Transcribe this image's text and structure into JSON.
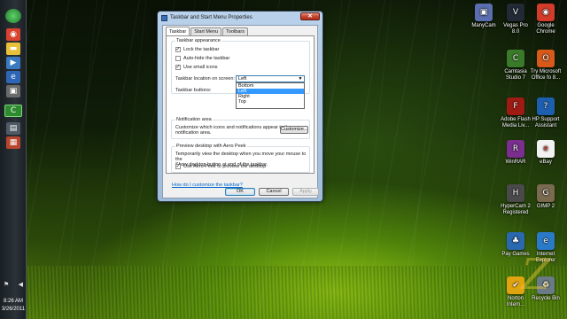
{
  "dialog": {
    "title": "Taskbar and Start Menu Properties",
    "tabs": [
      {
        "label": "Taskbar",
        "active": true
      },
      {
        "label": "Start Menu",
        "active": false
      },
      {
        "label": "Toolbars",
        "active": false
      }
    ],
    "appearance": {
      "group_title": "Taskbar appearance",
      "lock_label": "Lock the taskbar",
      "lock_checked": true,
      "autohide_label": "Auto-hide the taskbar",
      "autohide_checked": false,
      "small_icons_label": "Use small icons",
      "small_icons_checked": true,
      "location_label": "Taskbar location on screen:",
      "location_value": "Left",
      "location_options": [
        "Bottom",
        "Left",
        "Right",
        "Top"
      ],
      "location_selected_index": 1,
      "buttons_label": "Taskbar buttons:"
    },
    "notification": {
      "group_title": "Notification area",
      "description_line1": "Customize which icons and notifications appear in the",
      "description_line2": "notification area.",
      "customize_button": "Customize..."
    },
    "aero_peek": {
      "group_title": "Preview desktop with Aero Peek",
      "description_line1": "Temporarily view the desktop when you move your mouse to the",
      "description_line2": "Show desktop button at end of the taskbar.",
      "checkbox_label": "Use Aero Peek to preview the desktop",
      "checked": true
    },
    "help_link": "How do I customize the taskbar?",
    "ok_button": "OK",
    "cancel_button": "Cancel",
    "apply_button": "Apply",
    "close_glyph": "✕",
    "check_glyph": "✓"
  },
  "taskbar": {
    "time": "8:26 AM",
    "date": "3/26/2011"
  },
  "desktop_icons": [
    {
      "label": "ManyCam",
      "icon": "manycam-icon",
      "color": "#5b6fb0",
      "glyph": "▣"
    },
    {
      "label": "Vegas Pro 8.0",
      "icon": "vegas-icon",
      "color": "#222a36",
      "glyph": "V"
    },
    {
      "label": "Google Chrome",
      "icon": "chrome-icon",
      "color": "#d33c2a",
      "glyph": "◉"
    },
    {
      "label": "Camtasia Studio 7",
      "icon": "camtasia-icon",
      "color": "#3a7a2a",
      "glyph": "C"
    },
    {
      "label": "Try Microsoft Office fo 8...",
      "icon": "office-icon",
      "color": "#d75a1a",
      "glyph": "O"
    },
    {
      "label": "Adobe Flash Media Liv...",
      "icon": "flash-icon",
      "color": "#9e1b14",
      "glyph": "F"
    },
    {
      "label": "HP Support Assistant",
      "icon": "hp-icon",
      "color": "#1d5fae",
      "glyph": "?"
    },
    {
      "label": "WinRAR",
      "icon": "winrar-icon",
      "color": "#7a2e8e",
      "glyph": "R"
    },
    {
      "label": "eBay",
      "icon": "ebay-icon",
      "color": "#f2f2f2",
      "glyph": "e"
    },
    {
      "label": "HyperCam 2 Registered",
      "icon": "hypercam-icon",
      "color": "#4a4a4a",
      "glyph": "H"
    },
    {
      "label": "GIMP 2",
      "icon": "gimp-icon",
      "color": "#7a6a50",
      "glyph": "G"
    },
    {
      "label": "Pay Games",
      "icon": "games-icon",
      "color": "#2a68b0",
      "glyph": "♣"
    },
    {
      "label": "Internet Explorer",
      "icon": "ie-icon",
      "color": "#2a7ac8",
      "glyph": "e"
    },
    {
      "label": "Norton Intern...",
      "icon": "norton-icon",
      "color": "#e0a410",
      "glyph": "✔"
    },
    {
      "label": "Recycle Bin",
      "icon": "recycle-bin-icon",
      "color": "#6a7a86",
      "glyph": "♻"
    }
  ],
  "watermark": "Z"
}
